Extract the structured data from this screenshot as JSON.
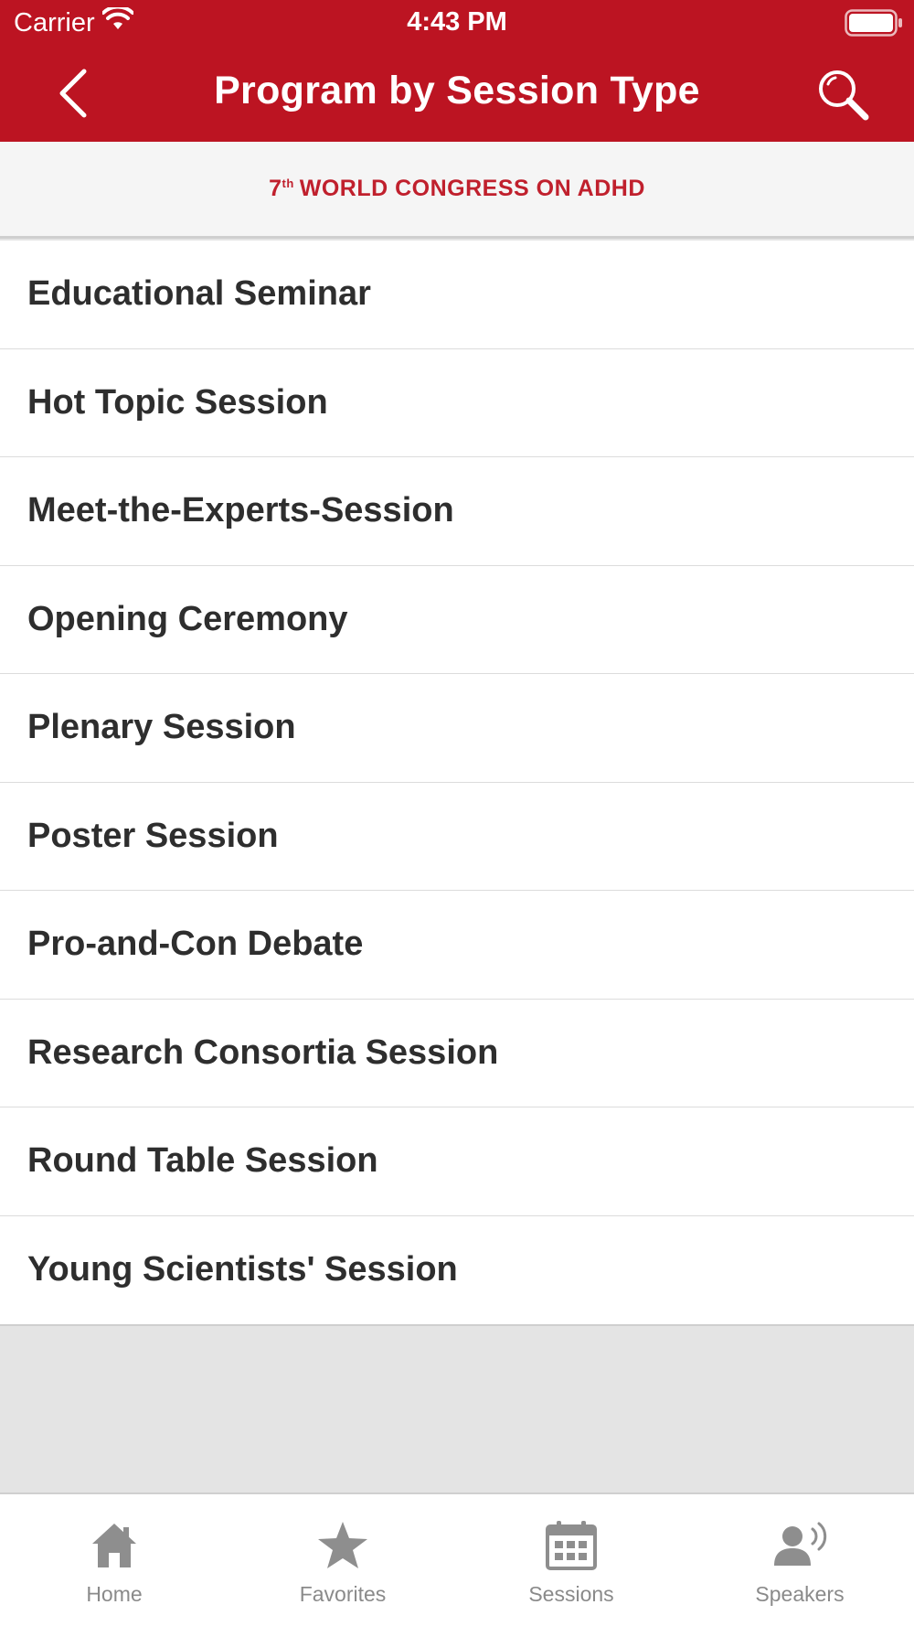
{
  "status_bar": {
    "carrier": "Carrier",
    "time": "4:43 PM"
  },
  "navbar": {
    "title": "Program by Session Type",
    "back_icon": "chevron-left-icon",
    "search_icon": "search-icon"
  },
  "banner": {
    "number": "7",
    "superscript": "th",
    "text": "WORLD CONGRESS ON ADHD"
  },
  "session_types": [
    "Educational Seminar",
    "Hot Topic Session",
    "Meet-the-Experts-Session",
    "Opening Ceremony",
    "Plenary Session",
    "Poster Session",
    "Pro-and-Con Debate",
    "Research Consortia Session",
    "Round Table Session",
    "Young Scientists' Session"
  ],
  "tabbar": {
    "items": [
      {
        "label": "Home",
        "icon": "home-icon"
      },
      {
        "label": "Favorites",
        "icon": "star-icon"
      },
      {
        "label": "Sessions",
        "icon": "calendar-icon"
      },
      {
        "label": "Speakers",
        "icon": "speaker-icon"
      }
    ]
  },
  "colors": {
    "brand_red": "#bc1422",
    "banner_text": "#c0202d",
    "tab_inactive": "#8a8a8a"
  }
}
